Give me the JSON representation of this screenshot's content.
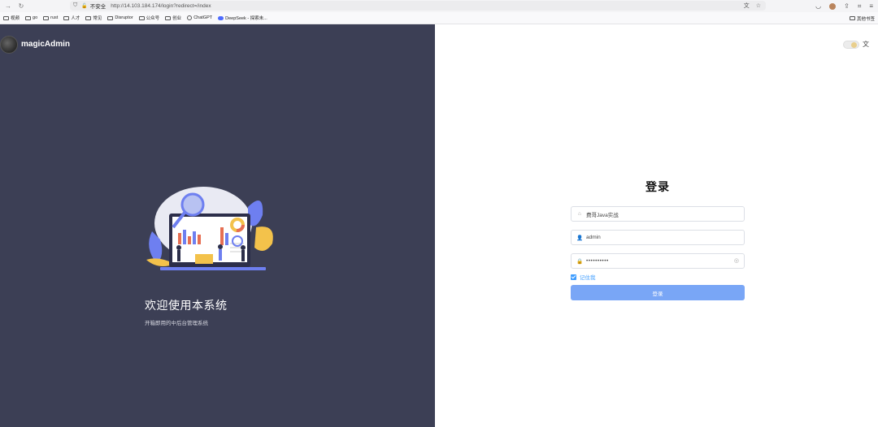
{
  "browser": {
    "url": "http://14.103.184.174/login?redirect=/index",
    "security_label": "不安全",
    "bookmarks": [
      "视频",
      "go",
      "rust",
      "人才",
      "常见",
      "Disruptor",
      "公众号",
      "创业",
      "ChatGPT",
      "DeepSeek - 探索未..."
    ],
    "other_bookmarks": "其他书签"
  },
  "brand": {
    "name": "magicAdmin"
  },
  "hero": {
    "welcome": "欢迎使用本系统",
    "subtitle": "开箱即用的中后台管理系统"
  },
  "login": {
    "title": "登录",
    "tenant_value": "费哥Java实战",
    "username_value": "admin",
    "password_mask": "••••••••••",
    "remember_label": "记住我",
    "submit_label": "登录"
  },
  "icons": {
    "lang": "translate-icon",
    "theme": "theme-toggle"
  },
  "colors": {
    "left_bg": "#3c3f55",
    "primary": "#409eff",
    "button": "#79a6f6"
  }
}
